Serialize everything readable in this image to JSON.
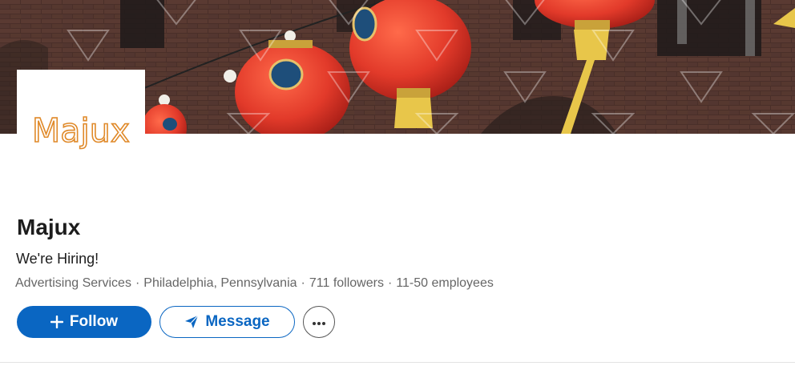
{
  "company": {
    "name": "Majux",
    "tagline": "We're Hiring!",
    "logo_text": "Majux",
    "industry": "Advertising Services",
    "location": "Philadelphia, Pennsylvania",
    "followers": "711 followers",
    "employees": "11-50 employees",
    "separator": "·"
  },
  "actions": {
    "follow_label": "Follow",
    "message_label": "Message"
  },
  "icons": {
    "follow": "plus-icon",
    "message": "send-icon",
    "more": "more-horizontal-icon"
  },
  "colors": {
    "primary": "#0a66c2",
    "logo_stroke": "#e08a2a",
    "text": "#1d1d1d",
    "muted": "#666666",
    "lantern": "#e23a2a",
    "tassel": "#e8c64a"
  }
}
